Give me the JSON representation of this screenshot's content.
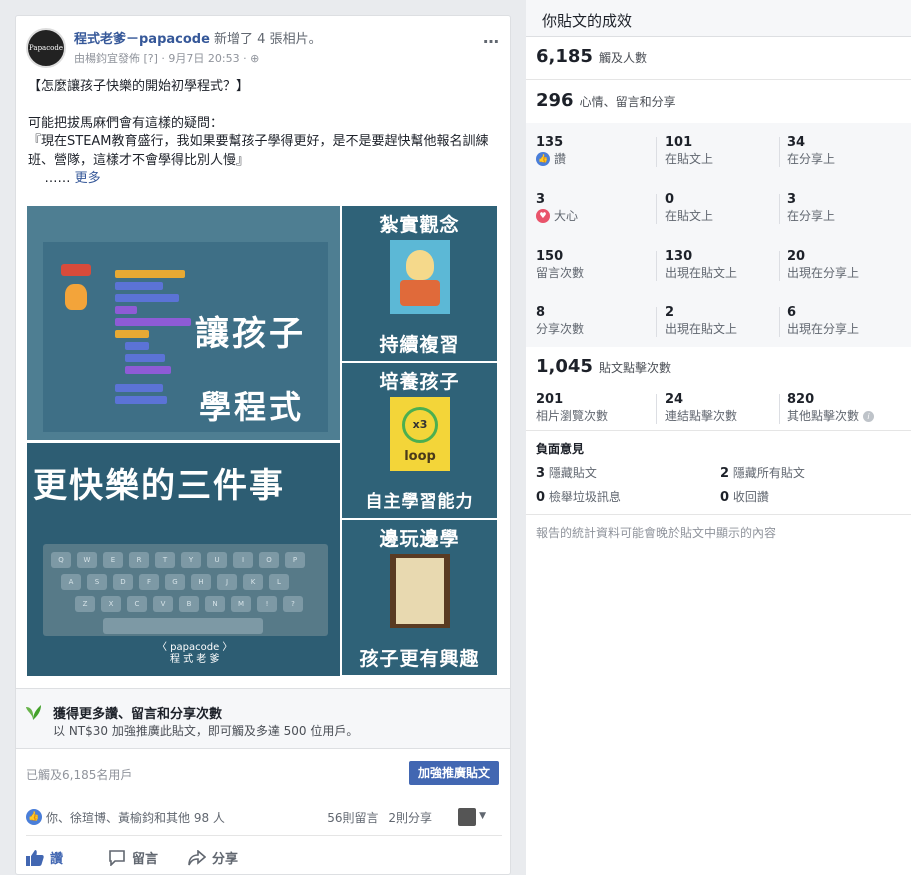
{
  "post": {
    "avatar_text": "Papacode",
    "page_name": "程式老爹－papacode",
    "action_text": " 新增了 4 張相片。",
    "meta": "由楊鈞宜發佈 [?] · 9月7日 20:53 · ⊕",
    "more_icon": "…",
    "text_line1": "【怎麼讓孩子快樂的開始初學程式？】",
    "text_line2": "可能把拔馬麻們會有這樣的疑問：",
    "text_line3": "『現在STEAM教育盛行，我如果要幫孩子學得更好，是不是要趕快幫他報名訓練班、營隊，這樣才不會學得比別人慢』",
    "text_ellipsis": "    …… ",
    "more_link": "更多",
    "images": {
      "big_title1": "讓孩子",
      "big_title2": "學程式",
      "big_title3": "更快樂的三件事",
      "brand": "〈 papacode 〉\n程 式 老 爹",
      "tile1_top": "紮實觀念",
      "tile1_bottom": "持續複習",
      "tile2_top": "培養孩子",
      "tile2_mid": "loop",
      "tile2_x": "x3",
      "tile2_bottom": "自主學習能力",
      "tile3_top": "邊玩邊學",
      "tile3_bottom": "孩子更有興趣",
      "keyboard_row1": [
        "Q",
        "W",
        "E",
        "R",
        "T",
        "Y",
        "U",
        "I",
        "O",
        "P"
      ],
      "keyboard_row2": [
        "A",
        "S",
        "D",
        "F",
        "G",
        "H",
        "J",
        "K",
        "L"
      ],
      "keyboard_row3": [
        "Z",
        "X",
        "C",
        "V",
        "B",
        "N",
        "M",
        "!",
        "?"
      ]
    },
    "promo_title": "獲得更多讚、留言和分享次數",
    "promo_sub": "以 NT$30 加強推廣此貼文，即可觸及多達 500 位用戶。",
    "reach_text": "已觸及6,185名用戶",
    "boost_label": "加強推廣貼文",
    "reaction_names": "你、徐瑄博、黃榆鈞和其他 98 人",
    "comment_count": "56則留言",
    "share_count": "2則分享",
    "actions": {
      "like": "讚",
      "comment": "留言",
      "share": "分享"
    }
  },
  "insights": {
    "title": "你貼文的成效",
    "reach_num": "6,185",
    "reach_label": "觸及人數",
    "engage_num": "296",
    "engage_label": "心情、留言和分享",
    "rows": [
      {
        "c1_num": "135",
        "c1_lbl": "讚",
        "c2_num": "101",
        "c2_lbl": "在貼文上",
        "c3_num": "34",
        "c3_lbl": "在分享上"
      },
      {
        "c1_num": "3",
        "c1_lbl": "大心",
        "c2_num": "0",
        "c2_lbl": "在貼文上",
        "c3_num": "3",
        "c3_lbl": "在分享上"
      },
      {
        "c1_num": "150",
        "c1_lbl": "留言次數",
        "c2_num": "130",
        "c2_lbl": "出現在貼文上",
        "c3_num": "20",
        "c3_lbl": "出現在分享上"
      },
      {
        "c1_num": "8",
        "c1_lbl": "分享次數",
        "c2_num": "2",
        "c2_lbl": "出現在貼文上",
        "c3_num": "6",
        "c3_lbl": "出現在分享上"
      }
    ],
    "clicks_num": "1,045",
    "clicks_label": "貼文點擊次數",
    "clicks": {
      "photo_num": "201",
      "photo_lbl": "相片瀏覽次數",
      "link_num": "24",
      "link_lbl": "連結點擊次數",
      "other_num": "820",
      "other_lbl": "其他點擊次數"
    },
    "negative_title": "負面意見",
    "neg": {
      "hide_post_num": "3",
      "hide_post_lbl": "隱藏貼文",
      "hide_all_num": "2",
      "hide_all_lbl": "隱藏所有貼文",
      "spam_num": "0",
      "spam_lbl": "檢舉垃圾訊息",
      "unlike_num": "0",
      "unlike_lbl": "收回讚"
    },
    "note": "報告的統計資料可能會晚於貼文中顯示的內容"
  }
}
